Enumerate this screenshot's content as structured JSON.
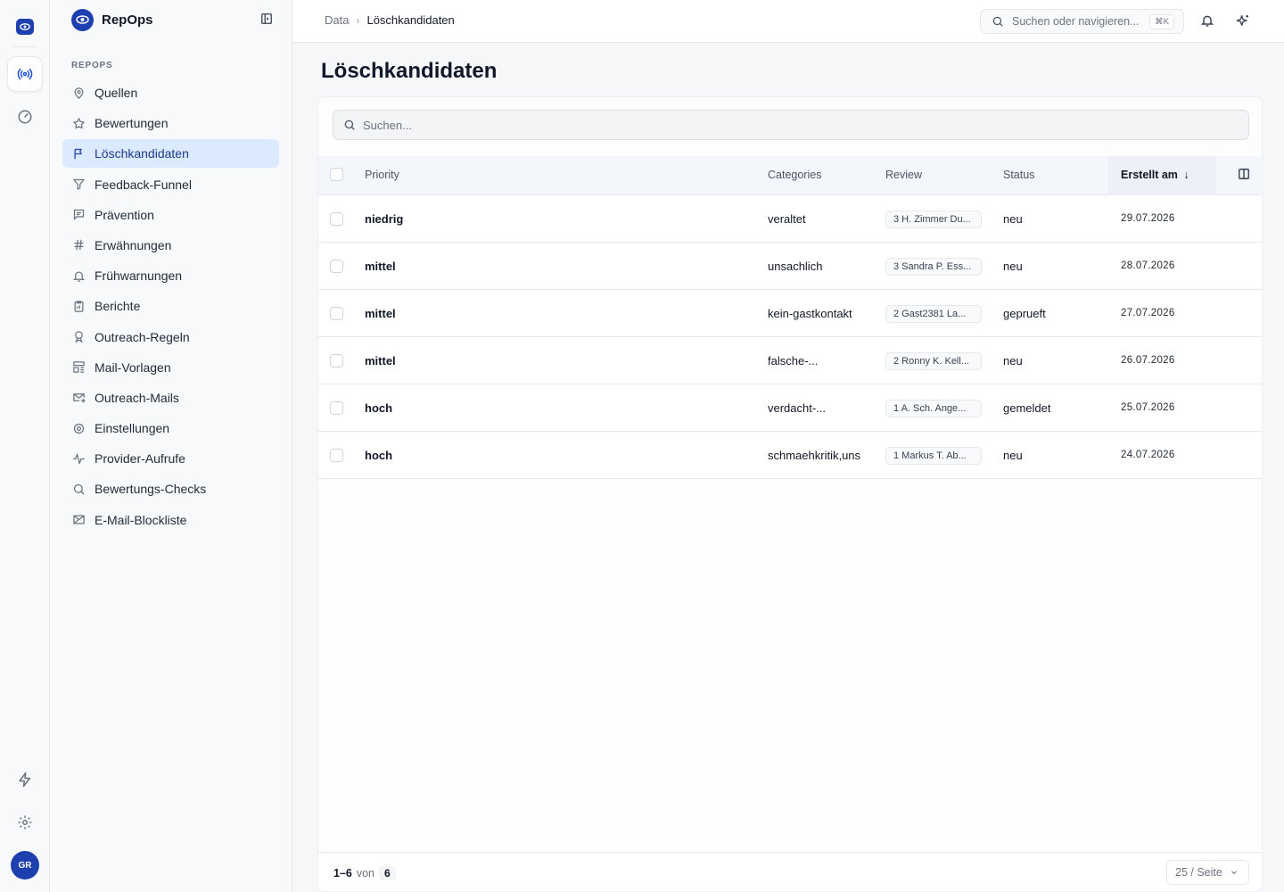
{
  "app": {
    "name": "RepOps",
    "avatar_initials": "GR",
    "accent_color": "#1e40af"
  },
  "rail": {
    "items": [
      {
        "icon": "radar-icon",
        "active": true
      },
      {
        "icon": "gauge-icon",
        "active": false
      }
    ],
    "bottom": [
      {
        "icon": "lightning-icon"
      },
      {
        "icon": "gear-icon"
      }
    ]
  },
  "sidebar": {
    "section_label": "REPOPS",
    "items": [
      {
        "label": "Quellen",
        "icon": "map-pin-icon",
        "active": false
      },
      {
        "label": "Bewertungen",
        "icon": "star-icon",
        "active": false
      },
      {
        "label": "Löschkandidaten",
        "icon": "flag-icon",
        "active": true
      },
      {
        "label": "Feedback-Funnel",
        "icon": "funnel-icon",
        "active": false
      },
      {
        "label": "Prävention",
        "icon": "message-square-icon",
        "active": false
      },
      {
        "label": "Erwähnungen",
        "icon": "hash-icon",
        "active": false
      },
      {
        "label": "Frühwarnungen",
        "icon": "bell-icon",
        "active": false
      },
      {
        "label": "Berichte",
        "icon": "clipboard-icon",
        "active": false
      },
      {
        "label": "Outreach-Regeln",
        "icon": "award-icon",
        "active": false
      },
      {
        "label": "Mail-Vorlagen",
        "icon": "layout-template-icon",
        "active": false
      },
      {
        "label": "Outreach-Mails",
        "icon": "mail-arrow-icon",
        "active": false
      },
      {
        "label": "Einstellungen",
        "icon": "gear-icon",
        "active": false
      },
      {
        "label": "Provider-Aufrufe",
        "icon": "activity-icon",
        "active": false
      },
      {
        "label": "Bewertungs-Checks",
        "icon": "search-icon",
        "active": false
      },
      {
        "label": "E-Mail-Blockliste",
        "icon": "mail-x-icon",
        "active": false
      }
    ]
  },
  "header": {
    "breadcrumb_root": "Data",
    "breadcrumb_sep": "›",
    "breadcrumb_current": "Löschkandidaten",
    "search_placeholder": "Suchen oder navigieren...",
    "search_shortcut": "⌘K"
  },
  "page": {
    "title": "Löschkandidaten",
    "search_placeholder": "Suchen..."
  },
  "table": {
    "columns": {
      "priority": "Priority",
      "categories": "Categories",
      "review": "Review",
      "status": "Status",
      "created": "Erstellt am",
      "sort_indicator": "↓"
    },
    "rows": [
      {
        "priority": "niedrig",
        "categories": "veraltet",
        "review": "3 H. Zimmer Du...",
        "status": "neu",
        "created": "29.07.2026"
      },
      {
        "priority": "mittel",
        "categories": "unsachlich",
        "review": "3 Sandra P. Ess...",
        "status": "neu",
        "created": "28.07.2026"
      },
      {
        "priority": "mittel",
        "categories": "kein-gastkontakt",
        "review": "2 Gast2381 La...",
        "status": "geprueft",
        "created": "27.07.2026"
      },
      {
        "priority": "mittel",
        "categories": "falsche-...",
        "review": "2 Ronny K. Kell...",
        "status": "neu",
        "created": "26.07.2026"
      },
      {
        "priority": "hoch",
        "categories": "verdacht-...",
        "review": "1 A. Sch. Ange...",
        "status": "gemeldet",
        "created": "25.07.2026"
      },
      {
        "priority": "hoch",
        "categories": "schmaehkritik,uns",
        "review": "1 Markus T. Ab...",
        "status": "neu",
        "created": "24.07.2026"
      }
    ],
    "footer": {
      "range": "1–6",
      "of_label": "von",
      "total": "6",
      "page_size": "25 / Seite"
    }
  }
}
